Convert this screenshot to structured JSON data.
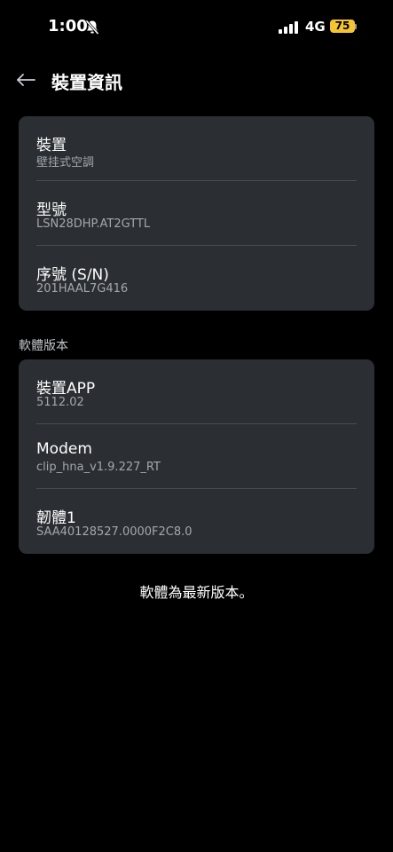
{
  "status_bar": {
    "time": "1:00",
    "network": "4G",
    "battery": "75",
    "battery_color": "#f4c531",
    "icons": [
      "bell-off-icon",
      "signal-icon"
    ]
  },
  "header": {
    "back_icon": "arrow-left-icon",
    "title": "裝置資訊"
  },
  "device_info": {
    "rows": [
      {
        "title": "裝置",
        "value": "壁挂式空調"
      },
      {
        "title": "型號",
        "value": "LSN28DHP.AT2GTTL"
      },
      {
        "title": "序號 (S/N)",
        "value": "201HAAL7G416"
      }
    ]
  },
  "software": {
    "section_label": "軟體版本",
    "rows": [
      {
        "title": "裝置APP",
        "value": "5112.02"
      },
      {
        "title": "Modem",
        "value": "clip_hna_v1.9.227_RT"
      },
      {
        "title": "韌體1",
        "value": "SAA40128527.0000F2C8.0"
      }
    ]
  },
  "update_status": "軟體為最新版本。",
  "colors": {
    "background": "#000000",
    "card": "#2b2f33",
    "secondary_text": "#a3a8ad"
  }
}
